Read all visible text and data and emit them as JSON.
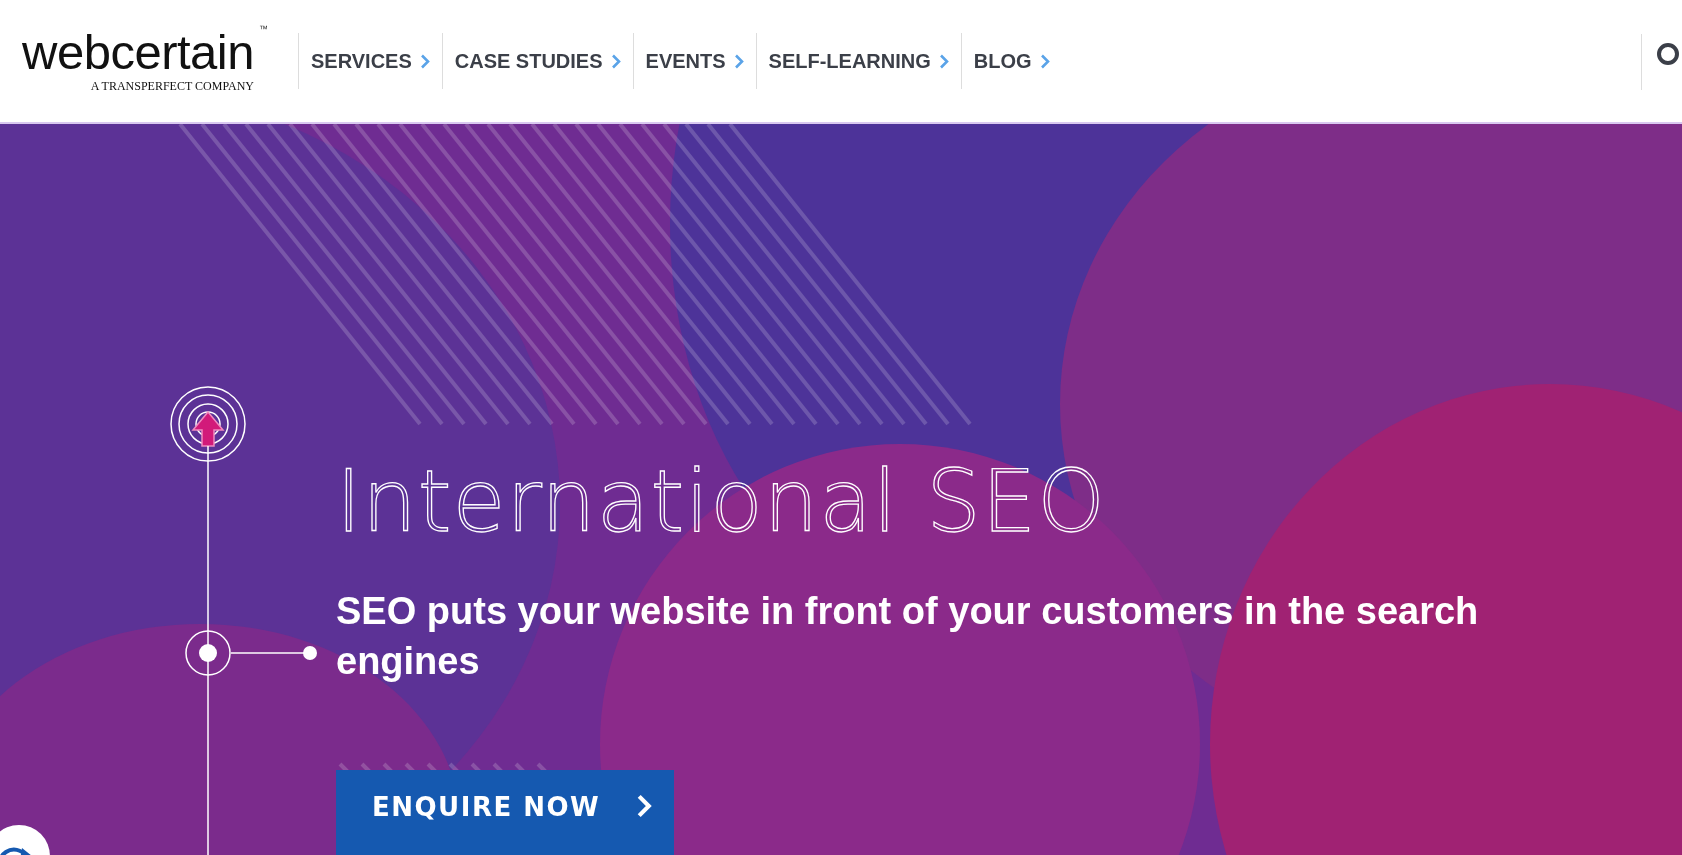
{
  "logo": {
    "name": "webcertain",
    "trademark": "™",
    "tagline": "A TRANSPERFECT COMPANY"
  },
  "nav": [
    {
      "label": "SERVICES"
    },
    {
      "label": "CASE STUDIES"
    },
    {
      "label": "EVENTS"
    },
    {
      "label": "SELF-LEARNING"
    },
    {
      "label": "BLOG"
    }
  ],
  "hero": {
    "title": "International SEO",
    "subtitle": "SEO puts your website in front of your customers in the search engines",
    "button": "ENQUIRE NOW"
  }
}
